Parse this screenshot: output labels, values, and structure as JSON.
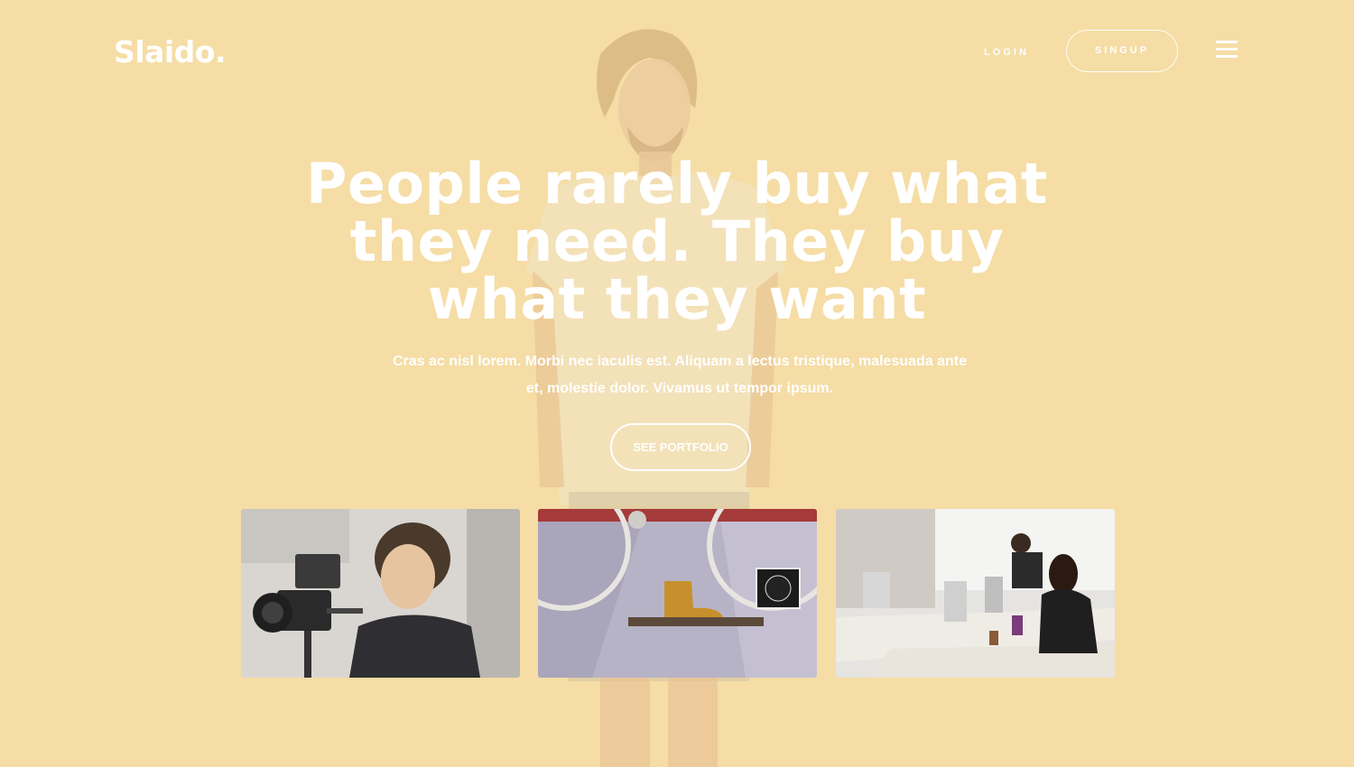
{
  "header": {
    "logo": "Slaido.",
    "login_label": "LOGIN",
    "signup_label": "SINGUP",
    "menu_icon": "hamburger-menu-icon"
  },
  "hero": {
    "title": "People rarely buy what they need. They buy what they want",
    "subtitle": "Cras ac nisl lorem. Morbi nec iaculis est. Aliquam a lectus tristique, malesuada ante et, molestie dolor. Vivamus ut tempor ipsum.",
    "cta_label": "SEE PORTFOLIO"
  },
  "gallery": {
    "items": [
      {
        "subject": "camera-operator-photo"
      },
      {
        "subject": "bicycle-and-shoe-shelf-photo"
      },
      {
        "subject": "office-workspace-photo"
      }
    ]
  },
  "colors": {
    "background": "#f5dea5",
    "text": "#ffffff"
  }
}
